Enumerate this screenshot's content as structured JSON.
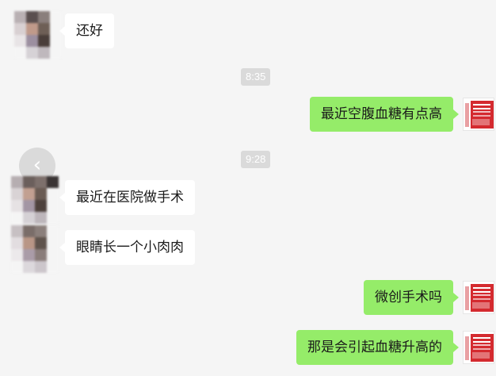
{
  "messages": [
    {
      "side": "left",
      "text": "还好"
    },
    {
      "side": "right",
      "text": "最近空腹血糖有点高"
    },
    {
      "side": "left",
      "text": "最近在医院做手术"
    },
    {
      "side": "left",
      "text": "眼睛长一个小肉肉"
    },
    {
      "side": "right",
      "text": "微创手术吗"
    },
    {
      "side": "right",
      "text": "那是会引起血糖升高的"
    }
  ],
  "timestamps": [
    "8:35",
    "9:28"
  ],
  "icons": {
    "back": "chevron-left-icon",
    "back_glyph": "‹"
  },
  "colors": {
    "background": "#f5f5f5",
    "incoming_bubble": "#ffffff",
    "outgoing_bubble": "#95ec69",
    "timestamp_badge": "#dadada"
  }
}
